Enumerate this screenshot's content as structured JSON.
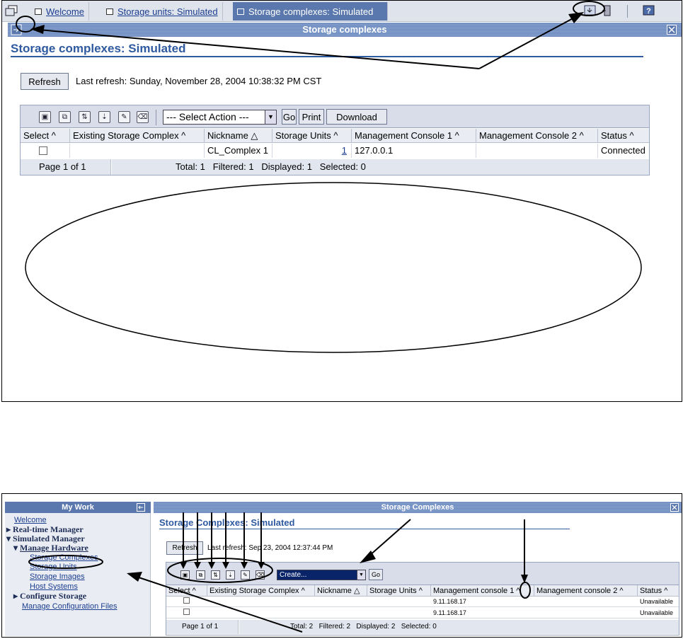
{
  "top": {
    "tabs": {
      "welcome": "Welcome",
      "storage_units": "Storage units: Simulated",
      "storage_complexes": "Storage complexes: Simulated"
    },
    "title_bar": "Storage complexes",
    "page_title": "Storage complexes: Simulated",
    "refresh_label": "Refresh",
    "last_refresh": "Last refresh: Sunday, November 28, 2004 10:38:32 PM CST",
    "select_action": "--- Select Action ---",
    "go_label": "Go",
    "print_label": "Print",
    "download_label": "Download",
    "columns": {
      "select": "Select ^",
      "existing": "Existing Storage Complex ^",
      "nickname": "Nickname △",
      "units": "Storage Units ^",
      "mc1": "Management Console 1 ^",
      "mc2": "Management Console 2 ^",
      "status": "Status ^"
    },
    "row": {
      "nickname": "CL_Complex 1",
      "units": "1",
      "mc1": "127.0.0.1",
      "status": "Connected"
    },
    "page": "Page 1 of 1",
    "totals": "Total: 1   Filtered: 1   Displayed: 1   Selected: 0"
  },
  "bottom": {
    "my_work": "My Work",
    "nav": {
      "welcome": "Welcome",
      "realtime": "Real-time Manager",
      "simulated": "Simulated Manager",
      "manage_hw": "Manage Hardware",
      "storage_complexes": "Storage Complexes",
      "storage_units": "Storage Units",
      "storage_images": "Storage Images",
      "host_systems": "Host Systems",
      "configure": "Configure Storage",
      "manage_cfg": "Manage Configuration Files"
    },
    "title_bar": "Storage Complexes",
    "page_title": "Storage Complexes: Simulated",
    "refresh_label": "Refresh",
    "last_refresh": "Last refresh: Sep 23, 2004 12:37:44 PM",
    "select_value": "Create...",
    "go_label": "Go",
    "columns": {
      "select": "Select ^",
      "existing": "Existing Storage Complex ^",
      "nickname": "Nickname △",
      "units": "Storage Units ^",
      "mc1": "Management console 1 ^",
      "mc2": "Management console 2 ^",
      "status": "Status ^"
    },
    "rows": [
      {
        "mc1": "9.11.168.17",
        "status": "Unavailable"
      },
      {
        "mc1": "9.11.168.17",
        "status": "Unavailable"
      }
    ],
    "page": "Page 1 of 1",
    "totals": "Total: 2   Filtered: 2   Displayed: 2   Selected: 0"
  }
}
